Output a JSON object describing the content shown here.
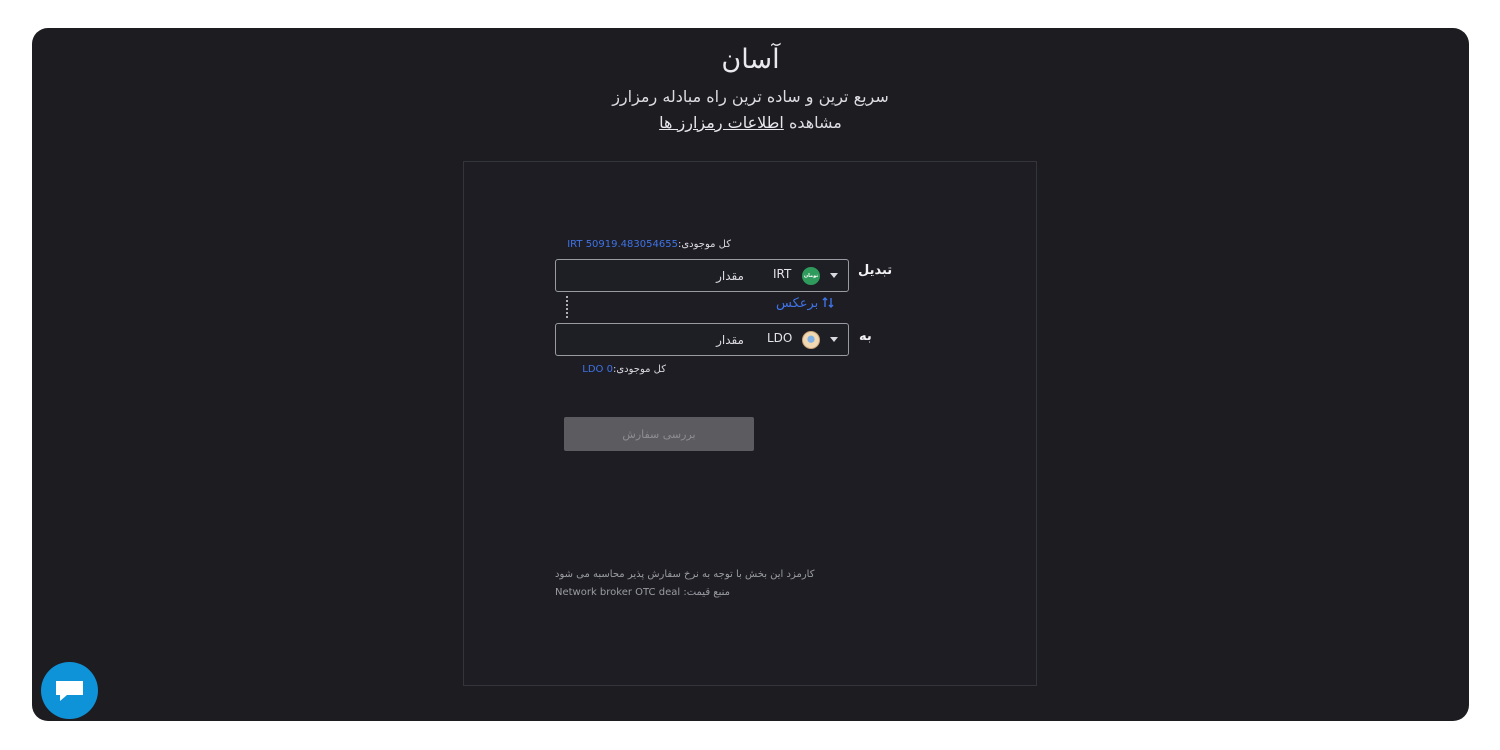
{
  "hero": {
    "title": "آسان",
    "subtitle": "سریع ترین و ساده ترین راه مبادله رمزارز",
    "view_prefix": "مشاهده",
    "view_link": "اطلاعات رمزارز ها"
  },
  "exchange": {
    "from": {
      "label": "تبدیل",
      "currency": "IRT",
      "coin_icon_text": "تومان",
      "amount_placeholder": "مقدار",
      "balance_label": "کل موجودی:",
      "balance_value": "IRT 50919.483054655"
    },
    "reverse_label": "برعکس",
    "to": {
      "label": "به",
      "currency": "LDO",
      "amount_placeholder": "مقدار",
      "balance_label": "کل موجودی:",
      "balance_value": "LDO 0"
    },
    "review_button": "بررسی سفارش",
    "fee_note": "کارمزد این بخش با توجه به نرخ سفارش پذیر محاسبه می شود",
    "price_source_label": "منبع قیمت:",
    "price_source_value": "Network broker OTC deal"
  },
  "icons": {
    "dropdown": "caret-down-icon",
    "swap": "swap-arrows-icon",
    "chat": "chat-bubble-icon"
  },
  "colors": {
    "panel_bg": "#1c1c21",
    "accent_blue": "#3f73e6",
    "chat_button": "#0f93d8",
    "toman_coin": "#2e9a5c"
  }
}
